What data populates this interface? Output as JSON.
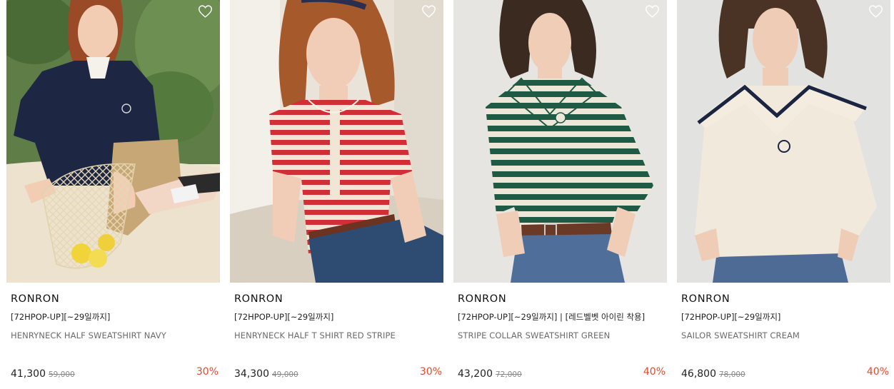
{
  "colors": {
    "discount": "#e8472b",
    "brand_text": "#111111",
    "product_name": "#6b6b6b"
  },
  "products": [
    {
      "brand": "RONRON",
      "promo": "[72HPOP-UP][~29일까지]",
      "name": "HENRYNECK HALF SWEATSHIRT NAVY",
      "price": "41,300",
      "original_price": "59,000",
      "discount": "30%",
      "wishlist_icon": "heart-outline-icon"
    },
    {
      "brand": "RONRON",
      "promo": "[72HPOP-UP][~29일까지]",
      "name": "HENRYNECK HALF T SHIRT RED STRIPE",
      "price": "34,300",
      "original_price": "49,000",
      "discount": "30%",
      "wishlist_icon": "heart-outline-icon"
    },
    {
      "brand": "RONRON",
      "promo": "[72HPOP-UP][~29일까지] | [레드벨벳 아이린 착용]",
      "name": "STRIPE COLLAR SWEATSHIRT GREEN",
      "price": "43,200",
      "original_price": "72,000",
      "discount": "40%",
      "wishlist_icon": "heart-outline-icon"
    },
    {
      "brand": "RONRON",
      "promo": "[72HPOP-UP][~29일까지]",
      "name": "SAILOR SWEATSHIRT CREAM",
      "price": "46,800",
      "original_price": "78,000",
      "discount": "40%",
      "wishlist_icon": "heart-outline-icon"
    }
  ]
}
